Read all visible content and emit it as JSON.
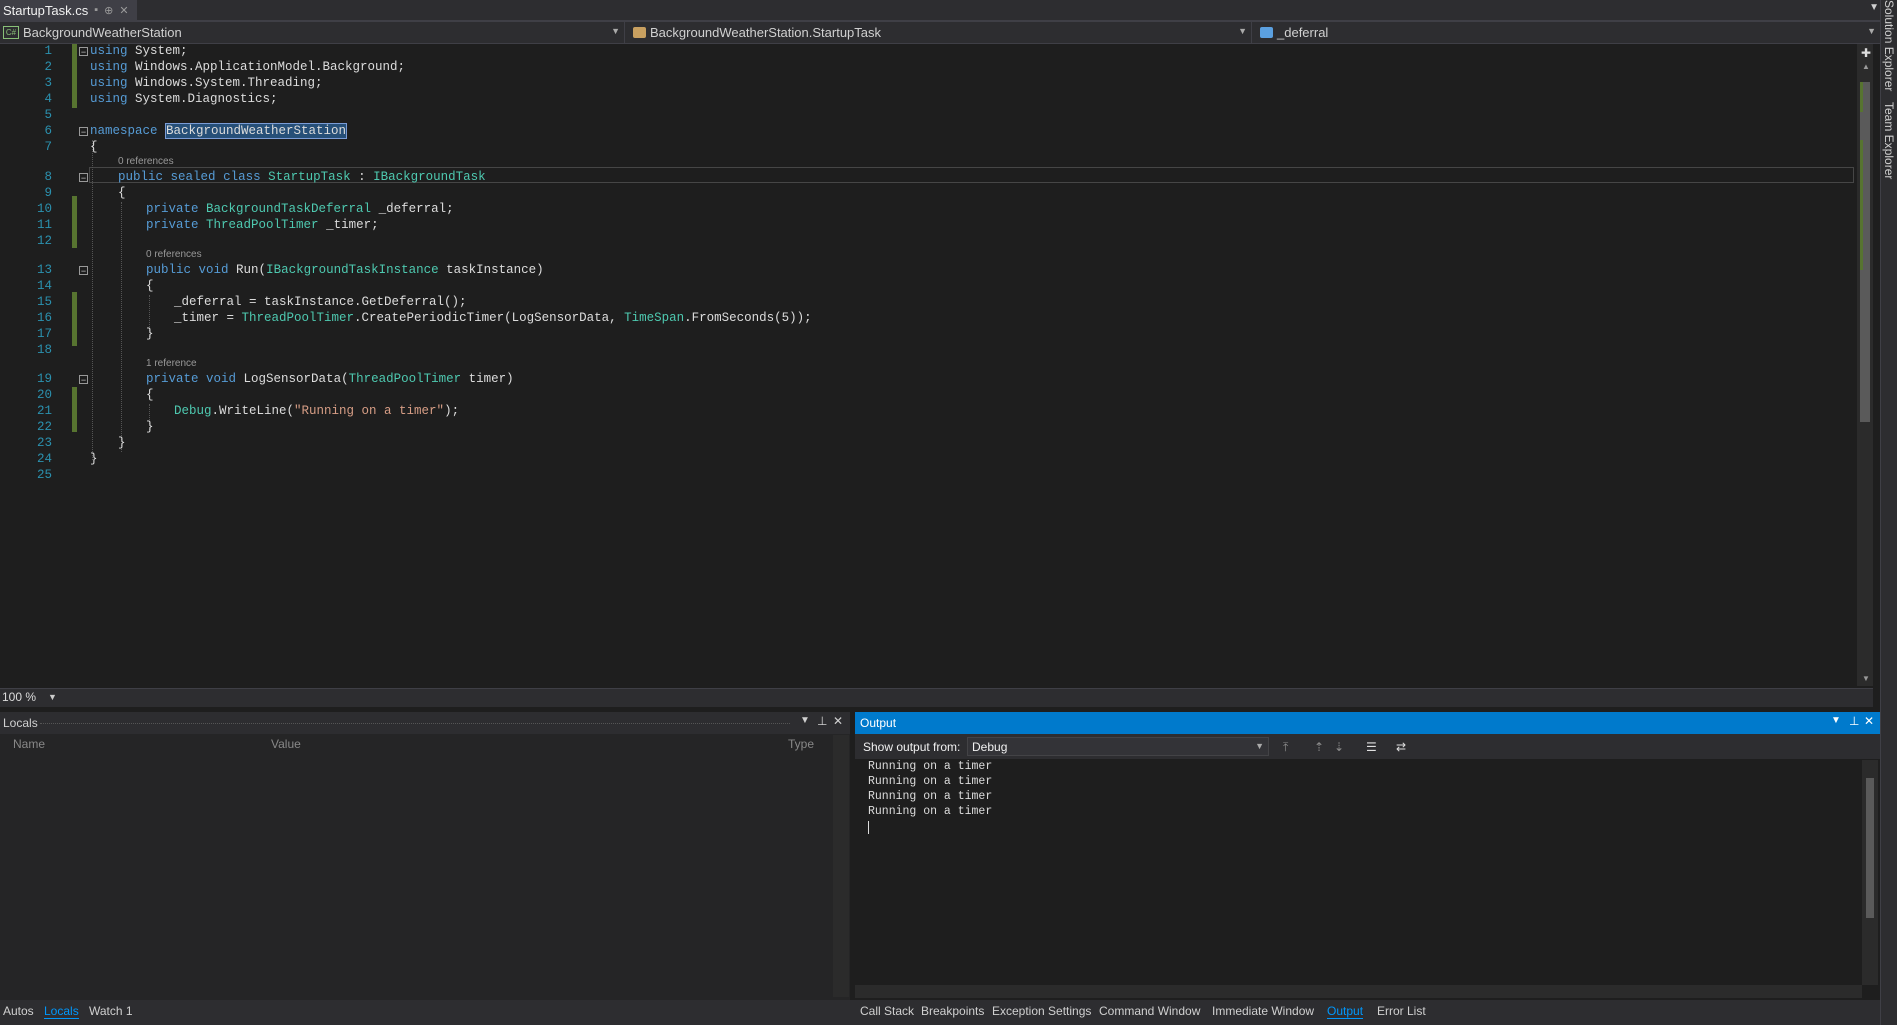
{
  "tab": {
    "title": "StartupTask.cs",
    "pin": "⊕",
    "close": "✕"
  },
  "nav": {
    "project": "BackgroundWeatherStation",
    "type": "BackgroundWeatherStation.StartupTask",
    "member": "_deferral"
  },
  "code": {
    "line_numbers": [
      "1",
      "2",
      "3",
      "4",
      "5",
      "6",
      "7",
      "8",
      "9",
      "10",
      "11",
      "12",
      "13",
      "14",
      "15",
      "16",
      "17",
      "18",
      "19",
      "20",
      "21",
      "22",
      "23",
      "24",
      "25"
    ],
    "codelens": [
      "0 references",
      "0 references",
      "1 reference"
    ],
    "tokens": {
      "using": "using",
      "system": " System;",
      "appmodel": " Windows.ApplicationModel.Background;",
      "threading": " Windows.System.Threading;",
      "diagnostics": " System.Diagnostics;",
      "namespace": "namespace",
      "ns_name": "BackgroundWeatherStation",
      "brace_open": "{",
      "brace_close": "}",
      "public": "public",
      "sealed": "sealed",
      "class": "class",
      "class_name": "StartupTask",
      "colon": " : ",
      "ibg": "IBackgroundTask",
      "private": "private",
      "deferral_type": "BackgroundTaskDeferral",
      "deferral_name": " _deferral;",
      "timer_type": "ThreadPoolTimer",
      "timer_name": " _timer;",
      "void": "void",
      "run": " Run(",
      "ibgi": "IBackgroundTaskInstance",
      "task_instance": " taskInstance)",
      "l15": "_deferral = taskInstance.GetDeferral();",
      "l16_a": "_timer = ",
      "l16_b": "ThreadPoolTimer",
      "l16_c": ".CreatePeriodicTimer(LogSensorData, ",
      "l16_d": "TimeSpan",
      "l16_e": ".FromSeconds(5));",
      "log_sig": " LogSensorData(",
      "tpt": "ThreadPoolTimer",
      "timer_param": " timer)",
      "debug": "Debug",
      "writeline": ".WriteLine(",
      "str": "\"Running on a timer\"",
      "end": ");"
    }
  },
  "zoom": {
    "label": "100 %"
  },
  "side_tabs": [
    "Solution Explorer",
    "Team Explorer"
  ],
  "locals": {
    "title": "Locals",
    "columns": {
      "name": "Name",
      "value": "Value",
      "type": "Type"
    }
  },
  "output": {
    "title": "Output",
    "show_from_label": "Show output from:",
    "source": "Debug",
    "lines": [
      "Running on a timer",
      "Running on a timer",
      "Running on a timer",
      "Running on a timer"
    ]
  },
  "bottom_tabs_left": [
    "Autos",
    "Locals",
    "Watch 1"
  ],
  "bottom_tabs_right": [
    "Call Stack",
    "Breakpoints",
    "Exception Settings",
    "Command Window",
    "Immediate Window",
    "Output",
    "Error List"
  ],
  "colors": {
    "accent": "#007acc",
    "keyword": "#569cd6",
    "type": "#4ec9b0",
    "string": "#d69d85",
    "line_number": "#2b91af",
    "change_bar": "#577430"
  }
}
